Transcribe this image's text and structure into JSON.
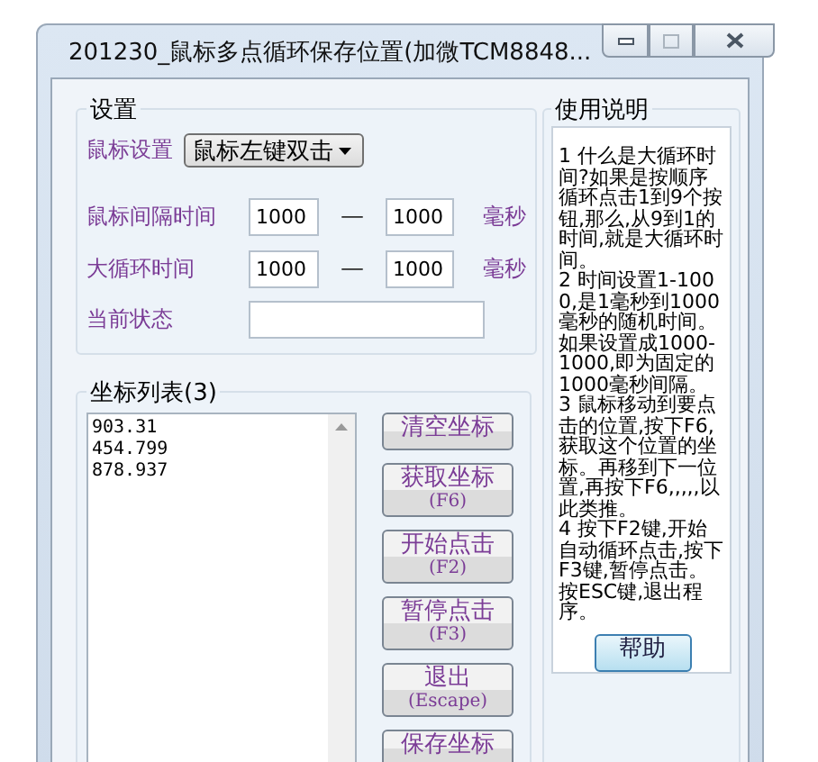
{
  "window": {
    "title": "201230_鼠标多点循环保存位置(加微TCM8848..."
  },
  "settings": {
    "title": "设置",
    "mouse_label": "鼠标设置",
    "mouse_value": "鼠标左键双击",
    "rows": [
      {
        "label": "鼠标间隔时间",
        "from": "1000",
        "dash": "—",
        "to": "1000",
        "unit": "毫秒"
      },
      {
        "label": "大循环时间",
        "from": "1000",
        "dash": "—",
        "to": "1000",
        "unit": "毫秒"
      }
    ],
    "status_label": "当前状态"
  },
  "coords": {
    "title": "坐标列表(3)",
    "items": [
      "903.31",
      "454.799",
      "878.937"
    ],
    "buttons": [
      {
        "label": "清空坐标"
      },
      {
        "label": "获取坐标",
        "sub": "(F6)"
      },
      {
        "label": "开始点击",
        "sub": "(F2)"
      },
      {
        "label": "暂停点击",
        "sub": "(F3)"
      },
      {
        "label": "退出",
        "sub": "(Escape)"
      },
      {
        "label": "保存坐标"
      }
    ]
  },
  "help": {
    "title": "使用说明",
    "paragraphs": [
      "1 什么是大循环时间?如果是按顺序循环点击1到9个按钮,那么,从9到1的时间,就是大循环时间。",
      "2 时间设置1-1000,是1毫秒到1000毫秒的随机时间。如果设置成1000-1000,即为固定的1000毫秒间隔。",
      "3 鼠标移动到要点击的位置,按下F6,获取这个位置的坐标。再移到下一位置,再按下F6,,,,,以此类推。",
      "4 按下F2键,开始自动循环点击,按下F3键,暂停点击。按ESC键,退出程序。"
    ],
    "button": "帮助"
  }
}
